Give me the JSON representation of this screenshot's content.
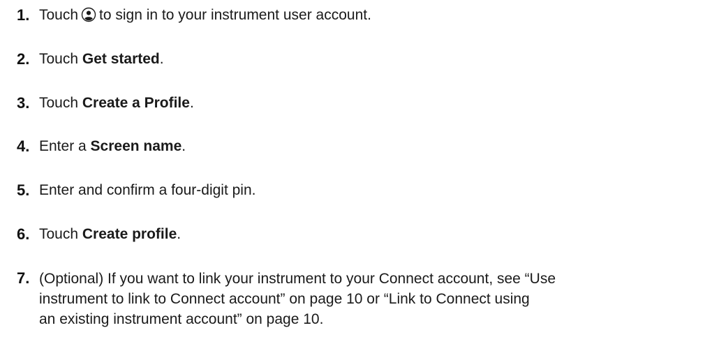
{
  "steps": [
    {
      "number": "1.",
      "pre": "Touch",
      "icon": "user-account-icon",
      "post": "to sign in to your instrument user account."
    },
    {
      "number": "2.",
      "pre": "Touch ",
      "bold": "Get started",
      "post": "."
    },
    {
      "number": "3.",
      "pre": "Touch ",
      "bold": "Create a Profile",
      "post": "."
    },
    {
      "number": "4.",
      "pre": "Enter a ",
      "bold": "Screen name",
      "post": "."
    },
    {
      "number": "5.",
      "text": "Enter and confirm a four-digit pin."
    },
    {
      "number": "6.",
      "pre": "Touch ",
      "bold": "Create profile",
      "post": "."
    },
    {
      "number": "7.",
      "line1": "(Optional) If you want to link your instrument to your Connect account, see “Use",
      "line2": "instrument to link to Connect account” on page 10 or “Link to Connect using",
      "line3": "an existing instrument account” on page 10."
    }
  ]
}
